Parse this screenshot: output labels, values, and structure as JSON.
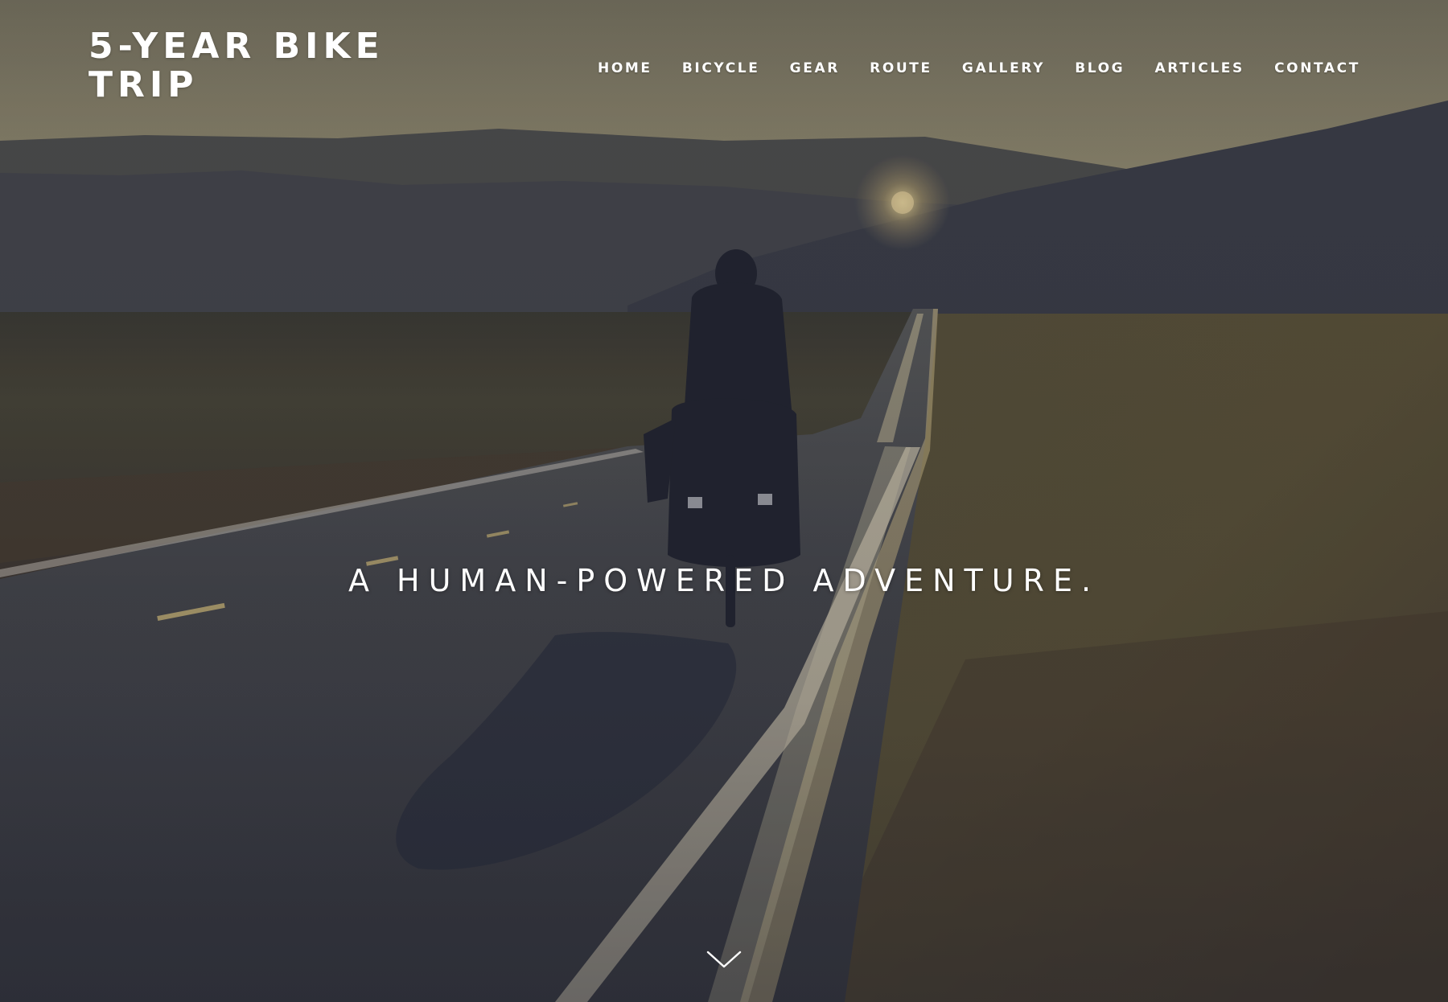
{
  "site": {
    "title": "5-YEAR BIKE TRIP"
  },
  "nav": {
    "items": [
      {
        "label": "HOME"
      },
      {
        "label": "BICYCLE"
      },
      {
        "label": "GEAR"
      },
      {
        "label": "ROUTE"
      },
      {
        "label": "GALLERY"
      },
      {
        "label": "BLOG"
      },
      {
        "label": "ARTICLES"
      },
      {
        "label": "CONTACT"
      }
    ]
  },
  "hero": {
    "tagline": "A HUMAN-POWERED ADVENTURE.",
    "scroll_icon": "chevron-down-icon"
  },
  "colors": {
    "text": "#ffffff",
    "sky": "#8c8366",
    "hills": "#3b3d46",
    "road": "#3a3a40",
    "road_line": "#e8d4a0"
  }
}
